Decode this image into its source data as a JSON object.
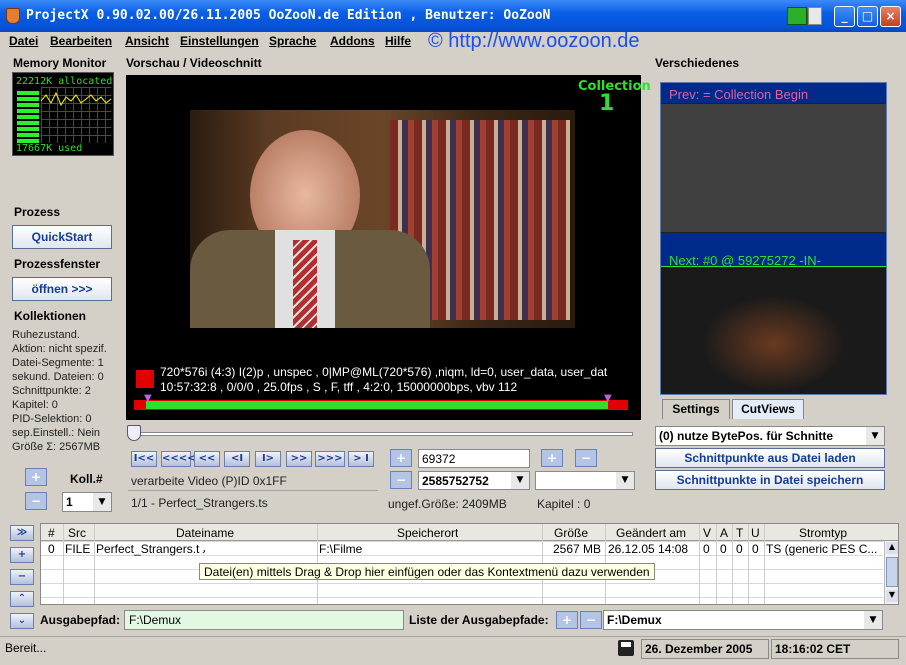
{
  "window": {
    "title": "ProjectX 0.90.02.00/26.11.2005 OoZooN.de Edition , Benutzer: OoZooN",
    "url": "© http://www.oozoon.de"
  },
  "menu": [
    "Datei",
    "Bearbeiten",
    "Ansicht",
    "Einstellungen",
    "Sprache",
    "Addons",
    "Hilfe"
  ],
  "memory": {
    "title": "Memory Monitor",
    "allocated": "22212K allocated",
    "used": "17667K used"
  },
  "preview": {
    "title": "Vorschau / Videoschnitt",
    "collection_label": "Collection",
    "collection_num": "1",
    "info_line1": "720*576i (4:3) I(2)p , unspec , 0|MP@ML(720*576)  ,niqm, ld=0, user_data, user_dat",
    "info_line2": "10:57:32:8 , 0/0/0 , 25.0fps , S , F, tff , 4:2:0, 15000000bps, vbv 112"
  },
  "nav": [
    "I<<",
    "<<<<",
    "<<",
    "<I",
    "I>",
    ">>",
    ">>>",
    "> I"
  ],
  "prozess": {
    "title": "Prozess",
    "button": "QuickStart"
  },
  "prozessfenster": {
    "title": "Prozessfenster",
    "button": "öffnen >>>"
  },
  "kollektionen": {
    "title": "Kollektionen",
    "lines": [
      "Ruhezustand.",
      "Aktion: nicht spezif.",
      "Datei-Segmente: 1",
      "sekund. Dateien: 0",
      "Schnittpunkte: 2",
      "Kapitel: 0",
      "PID-Selektion: 0",
      "sep.Einstell.: Nein",
      "Größe Σ: 2567MB"
    ],
    "koll_label": "Koll.#",
    "koll_value": "1"
  },
  "video_info": {
    "pid": "verarbeite Video (P)ID 0x1FF",
    "file": "1/1 - Perfect_Strangers.ts",
    "frame": "69372",
    "pos": "2585752752",
    "size": "ungef.Größe: 2409MB",
    "kapitel": "Kapitel :  0"
  },
  "verschiedenes": {
    "title": "Verschiedenes",
    "prev": "Prev: = Collection Begin",
    "next": "Next: #0 @ 59275272 -IN-",
    "tabs": [
      "Settings",
      "CutViews"
    ],
    "select": "(0) nutze BytePos. für Schnitte",
    "btn_load": "Schnittpunkte aus Datei laden",
    "btn_save": "Schnittpunkte in Datei speichern"
  },
  "table": {
    "headers": [
      "#",
      "Src",
      "Dateiname",
      "Speicherort",
      "Größe",
      "Geändert am",
      "V",
      "A",
      "T",
      "U",
      "Stromtyp"
    ],
    "rows": [
      [
        "0",
        "FILE",
        "Perfect_Strangers.ts",
        "F:\\Filme",
        "2567 MB",
        "26.12.05  14:08",
        "0",
        "0",
        "0",
        "0",
        "TS (generic PES C..."
      ]
    ],
    "tooltip": "Datei(en) mittels Drag & Drop hier einfügen oder das Kontextmenü dazu verwenden"
  },
  "output": {
    "label": "Ausgabepfad:",
    "value": "F:\\Demux",
    "list_label": "Liste der Ausgabepfade:",
    "list_value": "F:\\Demux"
  },
  "status": {
    "text": "Bereit...",
    "date": "26. Dezember 2005",
    "time": "18:16:02 CET"
  }
}
